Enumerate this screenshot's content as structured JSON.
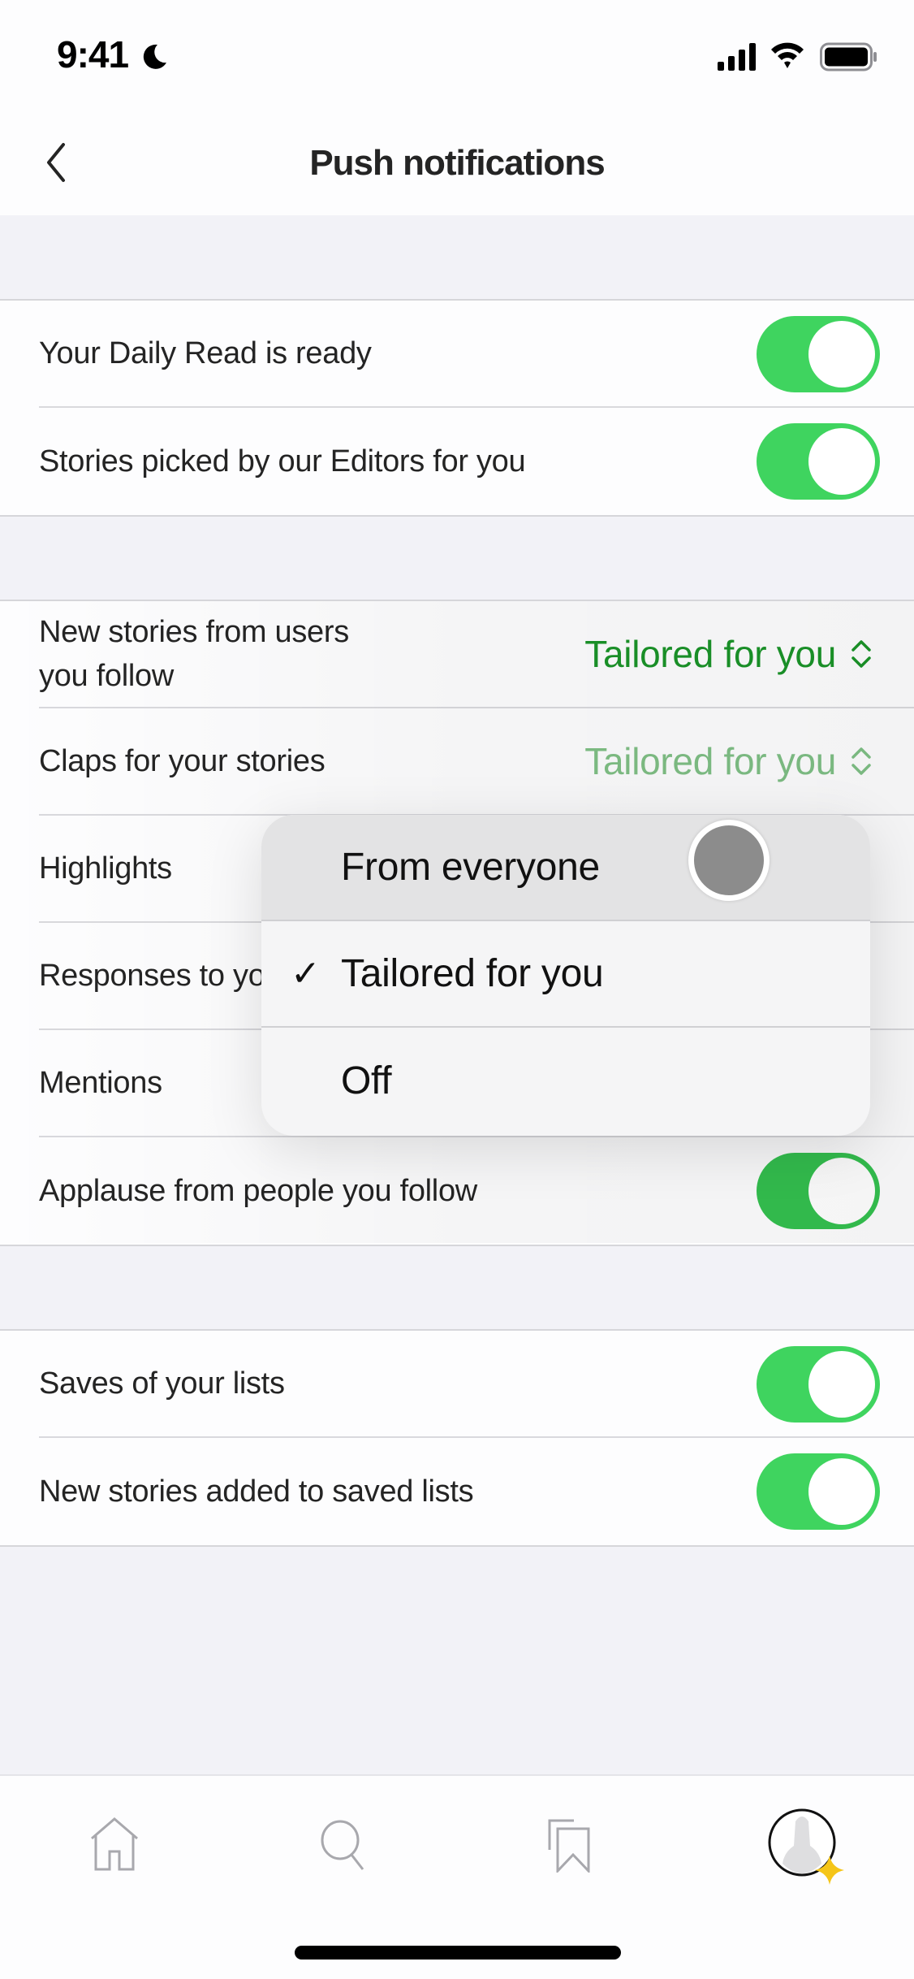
{
  "status_bar": {
    "time": "9:41",
    "focus_icon": "moon-icon",
    "signal_icon": "cellular-signal-icon",
    "wifi_icon": "wifi-icon",
    "battery_icon": "battery-icon"
  },
  "nav": {
    "title": "Push notifications",
    "back_icon": "chevron-left-icon"
  },
  "colors": {
    "toggle_on": "#3fd45f",
    "accent_green": "#1a9328",
    "background": "#f2f2f7",
    "premium_star": "#f5c518"
  },
  "groups": [
    {
      "rows": [
        {
          "label": "Your Daily Read is ready",
          "control": "toggle",
          "on": true
        },
        {
          "label": "Stories picked by our Editors for you",
          "control": "toggle",
          "on": true
        }
      ]
    },
    {
      "rows": [
        {
          "label": "New stories from users you follow",
          "control": "picker",
          "value": "Tailored for you"
        },
        {
          "label": "Claps for your stories",
          "control": "picker",
          "value": "Tailored for you"
        },
        {
          "label": "Highlights",
          "control": "picker"
        },
        {
          "label": "Responses to your stories",
          "control": "picker"
        },
        {
          "label": "Mentions",
          "control": "picker"
        },
        {
          "label": "Applause from people you follow",
          "control": "toggle",
          "on": true
        }
      ]
    },
    {
      "rows": [
        {
          "label": "Saves of your lists",
          "control": "toggle",
          "on": true
        },
        {
          "label": "New stories added to saved lists",
          "control": "toggle",
          "on": true
        }
      ]
    }
  ],
  "dropdown_menu": {
    "options": [
      {
        "label": "From everyone",
        "selected": false,
        "highlighted": true
      },
      {
        "label": "Tailored for you",
        "selected": true,
        "highlighted": false
      },
      {
        "label": "Off",
        "selected": false,
        "highlighted": false
      }
    ],
    "check_glyph": "✓"
  },
  "tab_bar": {
    "tabs": [
      {
        "name": "home",
        "icon": "home-icon"
      },
      {
        "name": "search",
        "icon": "search-icon"
      },
      {
        "name": "library",
        "icon": "bookmarks-icon"
      },
      {
        "name": "profile",
        "icon": "avatar-icon",
        "badge_icon": "sparkle-star-icon",
        "active": true
      }
    ]
  }
}
